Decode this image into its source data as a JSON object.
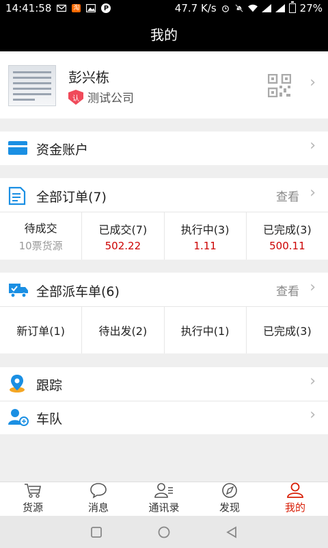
{
  "status_bar": {
    "time": "14:41:58",
    "app_badge": "淘",
    "p_badge": "P",
    "net_speed": "47.7 K/s",
    "battery": "27%"
  },
  "header": {
    "title": "我的"
  },
  "profile": {
    "name": "彭兴栋",
    "auth_badge": "认",
    "company": "测试公司"
  },
  "fund_account": {
    "label": "资金账户"
  },
  "orders": {
    "title": "全部订单(7)",
    "view_label": "查看",
    "stats": [
      {
        "label": "待成交",
        "value": "10票货源"
      },
      {
        "label": "已成交(7)",
        "value": "502.22"
      },
      {
        "label": "执行中(3)",
        "value": "1.11"
      },
      {
        "label": "已完成(3)",
        "value": "500.11"
      }
    ]
  },
  "dispatch": {
    "title": "全部派车单(6)",
    "view_label": "查看",
    "stats": [
      {
        "label": "新订单(1)"
      },
      {
        "label": "待出发(2)"
      },
      {
        "label": "执行中(1)"
      },
      {
        "label": "已完成(3)"
      }
    ]
  },
  "menu": {
    "tracking": "跟踪",
    "fleet": "车队"
  },
  "tabs": [
    {
      "label": "货源",
      "icon": "cart-icon"
    },
    {
      "label": "消息",
      "icon": "message-icon"
    },
    {
      "label": "通讯录",
      "icon": "contacts-icon"
    },
    {
      "label": "发现",
      "icon": "compass-icon"
    },
    {
      "label": "我的",
      "icon": "person-icon",
      "active": true
    }
  ],
  "colors": {
    "accent": "#d81e06",
    "icon_blue": "#1a8fe3",
    "value_red": "#cc0000"
  }
}
